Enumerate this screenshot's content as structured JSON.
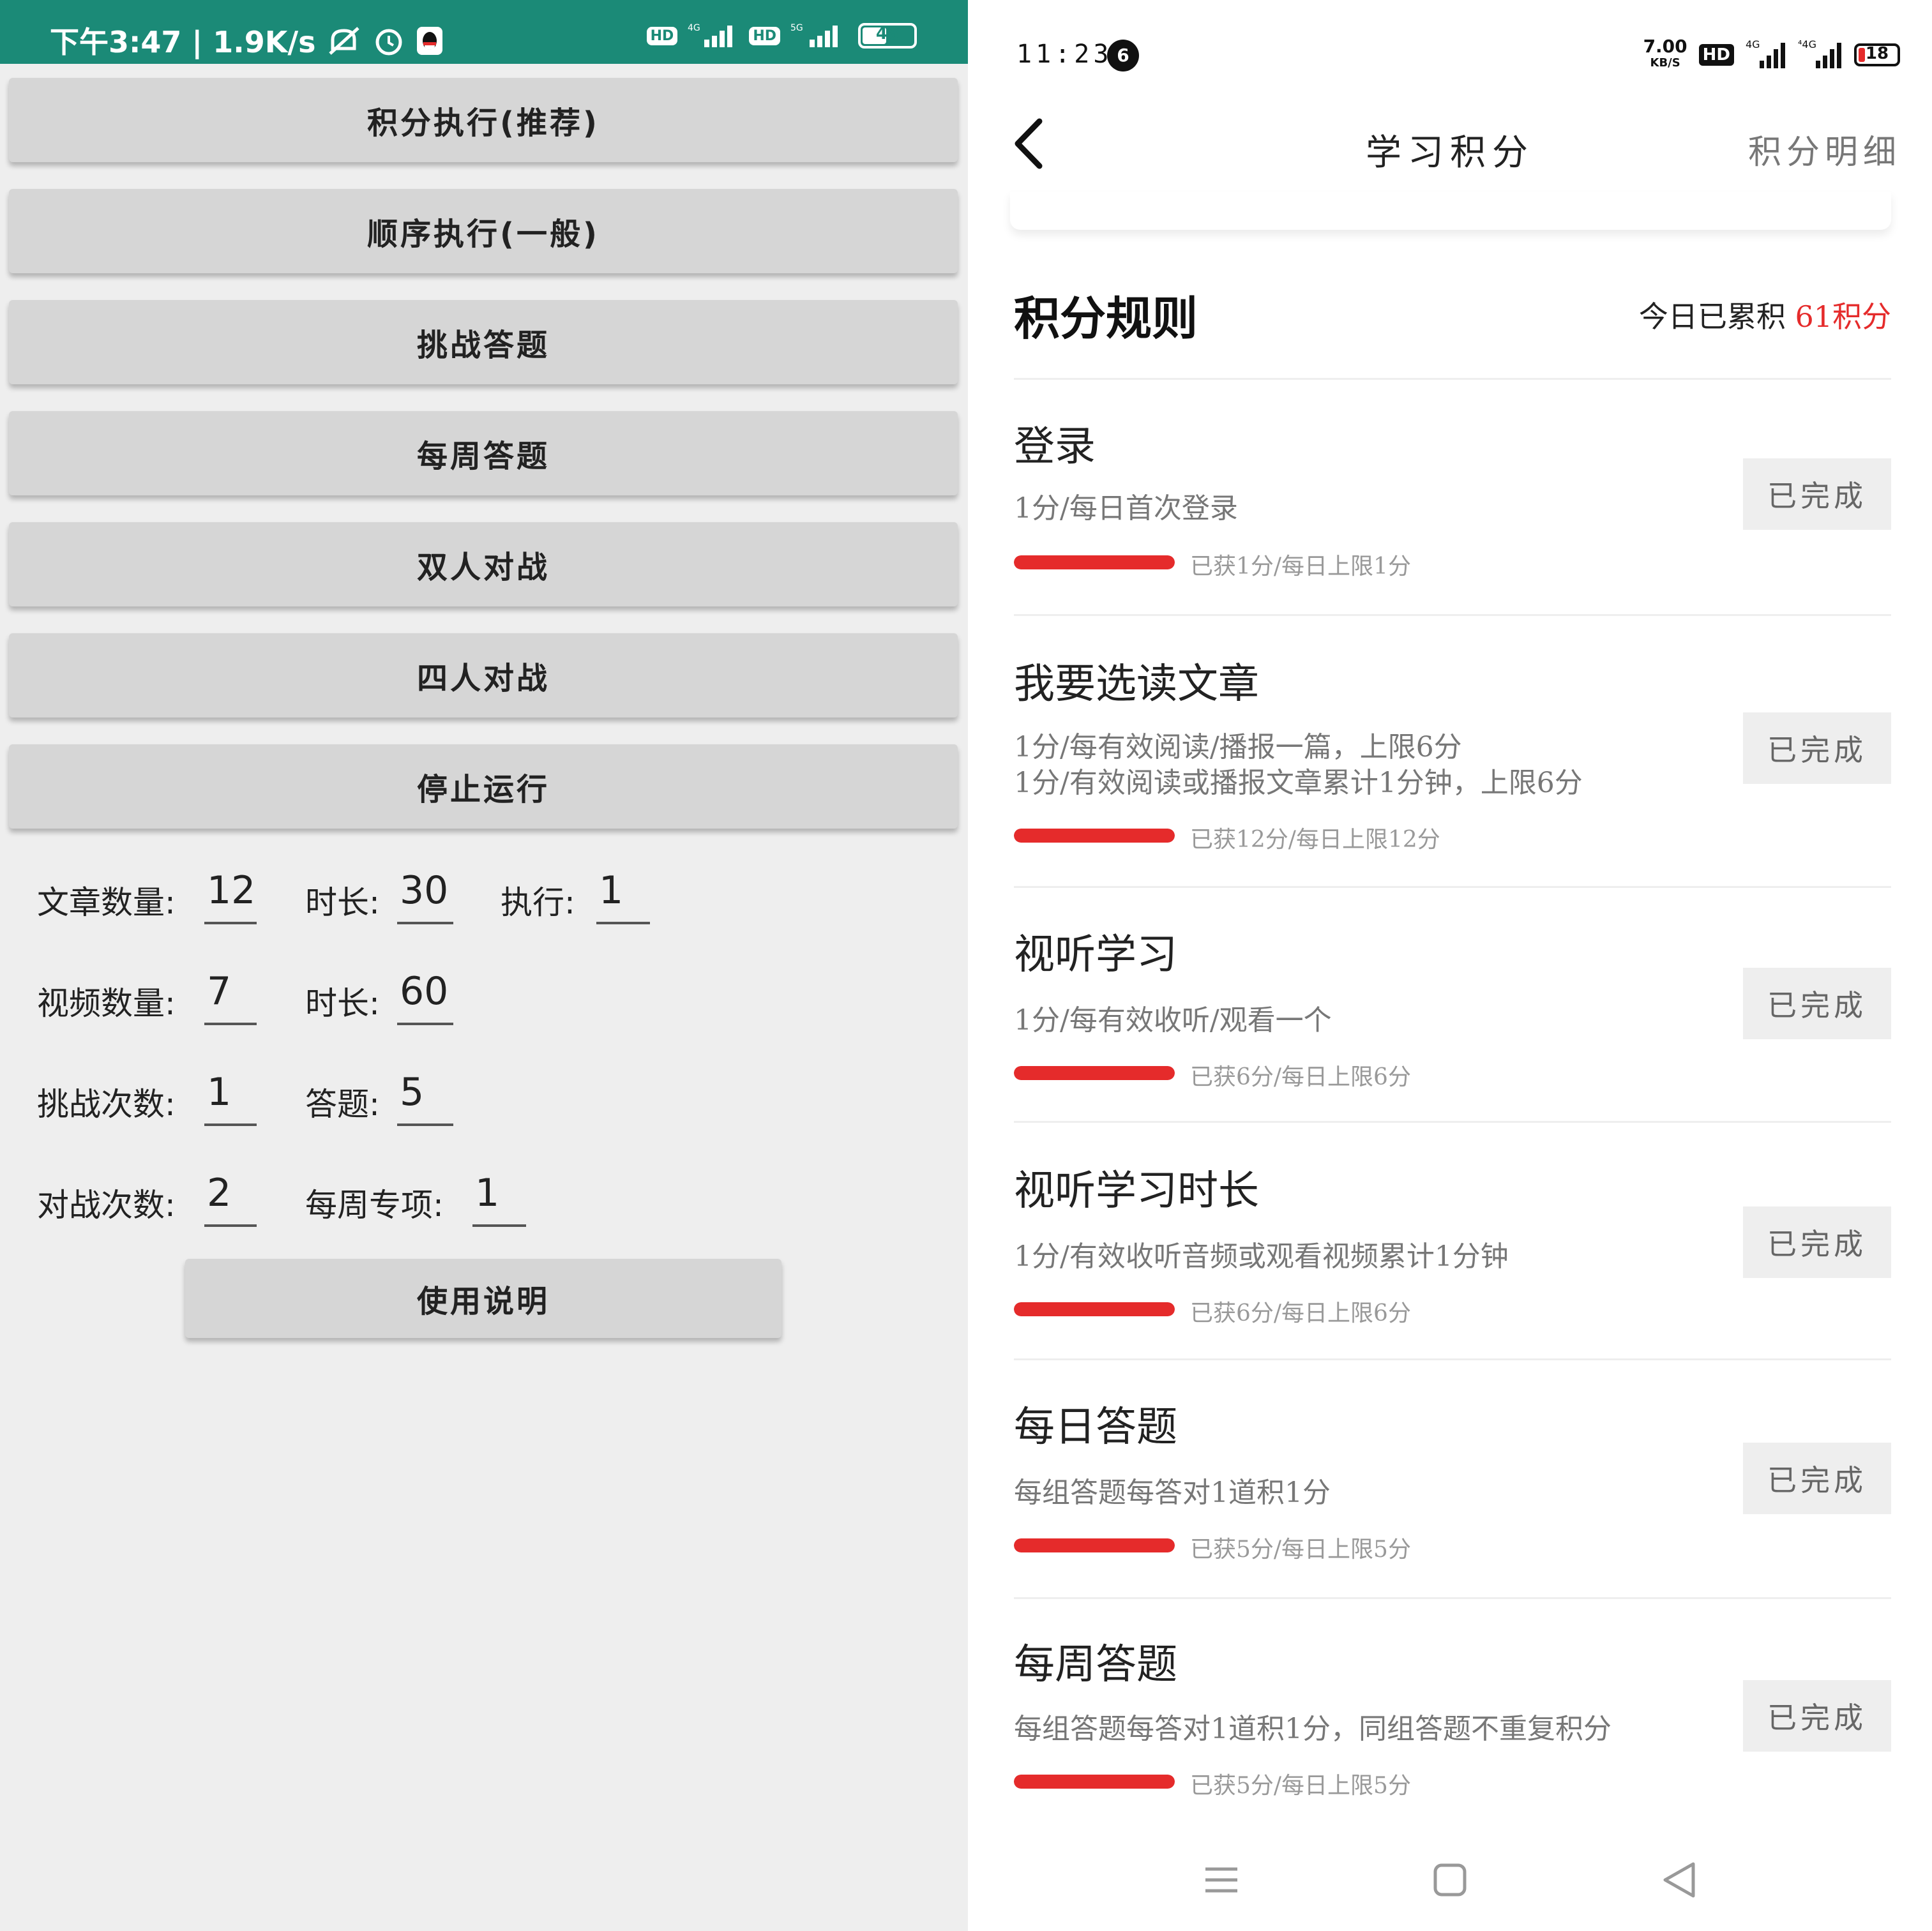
{
  "left": {
    "status_bar": {
      "time_text": "下午3:47 | 1.9K/s",
      "hd1": "HD",
      "net1": "4G",
      "hd2": "HD",
      "net2": "5G",
      "battery": "48",
      "battery_level": 0.48,
      "icons": [
        "mute-icon",
        "alarm-icon",
        "qq-icon",
        "signal-icon",
        "battery-icon"
      ]
    },
    "buttons": [
      "积分执行(推荐)",
      "顺序执行(一般)",
      "挑战答题",
      "每周答题",
      "双人对战",
      "四人对战",
      "停止运行"
    ],
    "fields": {
      "article_count": {
        "label": "文章数量:",
        "value": "12"
      },
      "article_duration": {
        "label": "时长:",
        "value": "30"
      },
      "execute": {
        "label": "执行:",
        "value": "1"
      },
      "video_count": {
        "label": "视频数量:",
        "value": "7"
      },
      "video_duration": {
        "label": "时长:",
        "value": "60"
      },
      "challenge_count": {
        "label": "挑战次数:",
        "value": "1"
      },
      "answers": {
        "label": "答题:",
        "value": "5"
      },
      "battle_count": {
        "label": "对战次数:",
        "value": "2"
      },
      "weekly_special": {
        "label": "每周专项:",
        "value": "1"
      }
    },
    "usage_button": "使用说明"
  },
  "right": {
    "status_bar": {
      "time": "11:23",
      "notif_count": "6",
      "speed": "7.00",
      "speed_unit": "KB/S",
      "hd": "HD",
      "net1": "4G",
      "net2": "4G",
      "battery": "18",
      "battery_level": 0.18
    },
    "nav": {
      "title": "学习积分",
      "detail_link": "积分明细",
      "back_icon": "chevron-left-icon"
    },
    "rules": {
      "title": "积分规则",
      "today_prefix": "今日已累积",
      "today_points": "61积分",
      "accent": "#e52b2b"
    },
    "items": [
      {
        "name": "登录",
        "desc": [
          "1分/每日首次登录"
        ],
        "progress": "已获1分/每日上限1分",
        "ratio": 1.0,
        "status": "已完成"
      },
      {
        "name": "我要选读文章",
        "desc": [
          "1分/每有效阅读/播报一篇，上限6分",
          "1分/有效阅读或播报文章累计1分钟，上限6分"
        ],
        "progress": "已获12分/每日上限12分",
        "ratio": 1.0,
        "status": "已完成"
      },
      {
        "name": "视听学习",
        "desc": [
          "1分/每有效收听/观看一个"
        ],
        "progress": "已获6分/每日上限6分",
        "ratio": 1.0,
        "status": "已完成"
      },
      {
        "name": "视听学习时长",
        "desc": [
          "1分/有效收听音频或观看视频累计1分钟"
        ],
        "progress": "已获6分/每日上限6分",
        "ratio": 1.0,
        "status": "已完成"
      },
      {
        "name": "每日答题",
        "desc": [
          "每组答题每答对1道积1分"
        ],
        "progress": "已获5分/每日上限5分",
        "ratio": 1.0,
        "status": "已完成"
      },
      {
        "name": "每周答题",
        "desc": [
          "每组答题每答对1道积1分，同组答题不重复积分"
        ],
        "progress": "已获5分/每日上限5分",
        "ratio": 1.0,
        "status": "已完成"
      }
    ],
    "navbar_icons": [
      "menu-icon",
      "home-icon",
      "back-triangle-icon"
    ]
  }
}
